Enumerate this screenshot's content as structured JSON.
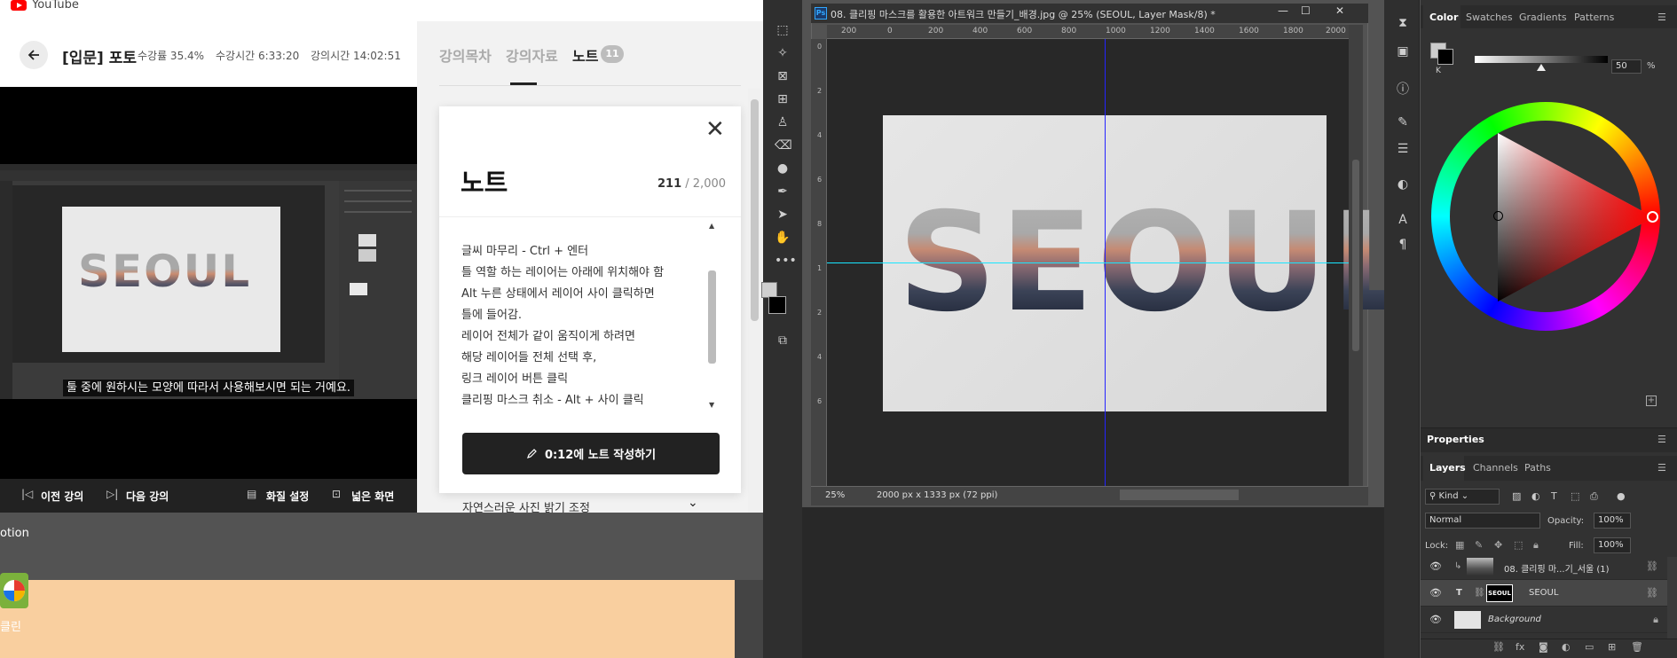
{
  "desktop": {
    "icon_label_1": "otion",
    "icon_label_2": "클린"
  },
  "lecture": {
    "site_name": "YouTube",
    "back_icon": "arrow-left-icon",
    "title": "[입문] 포토",
    "stats": {
      "progress": "수강률 35.4%",
      "watch_time": "수강시간 6:33:20",
      "length": "강의시간 14:02:51"
    },
    "video": {
      "subtitle": "툴 중에 원하시는 모양에 따라서 사용해보시면 되는 거예요.",
      "embedded_text": "SEOUL"
    },
    "controls": {
      "prev": "이전 강의",
      "next": "다음 강의",
      "quality": "화질 설정",
      "wide": "넓은 화면"
    },
    "tabs": {
      "curriculum": "강의목차",
      "materials": "강의자료",
      "notes": "노트",
      "notes_count": "11"
    },
    "note": {
      "heading": "노트",
      "char_count": "211",
      "char_limit": " / 2,000",
      "lines": [
        "글씨 마무리 - Ctrl + 엔터",
        "틀 역할 하는 레이어는 아래에 위치해야 함",
        "Alt 누른 상태에서 레이어 사이 클릭하면",
        "틀에 들어감.",
        "레이어 전체가 같이 움직이게 하려면",
        "해당 레이어들 전체 선택 후,",
        "링크 레이어 버튼 클릭",
        "클리핑 마스크 취소 - Alt  + 사이 클릭"
      ],
      "write_button": "0:12에 노트 작성하기"
    },
    "next_section": "자연스러운 사진 밝기 조정"
  },
  "photoshop": {
    "document": {
      "app_badge": "Ps",
      "title": "08. 클리핑 마스크를 활용한 아트워크 만들기_배경.jpg @ 25% (SEOUL, Layer Mask/8) *",
      "canvas_text": "SEOUL",
      "ruler_top": [
        "200",
        "0",
        "200",
        "400",
        "600",
        "800",
        "1000",
        "1200",
        "1400",
        "1600",
        "1800",
        "2000"
      ],
      "ruler_left": [
        "0",
        "2",
        "4",
        "6",
        "8",
        "1",
        "2",
        "4",
        "6"
      ],
      "zoom": "25%",
      "doc_info": "2000 px x 1333 px (72 ppi)",
      "guide_v_color": "#2424ff",
      "guide_h_color": "#18e6ff"
    },
    "color_panel": {
      "tabs": [
        "Color",
        "Swatches",
        "Gradients",
        "Patterns"
      ],
      "channel_label": "K",
      "k_value": "50",
      "percent": "%",
      "k_level_percent": 50,
      "fg_color": "#cccccc",
      "bg_color": "#000000"
    },
    "properties_tab": "Properties",
    "layers_panel": {
      "tabs": [
        "Layers",
        "Channels",
        "Paths"
      ],
      "kind": "Kind",
      "blend_mode": "Normal",
      "opacity_label": "Opacity:",
      "opacity": "100%",
      "lock_label": "Lock:",
      "fill_label": "Fill:",
      "fill": "100%",
      "layers": [
        {
          "name": "08. 클리핑 마...기_서울 (1)",
          "type": "photo-clipped"
        },
        {
          "name": "SEOUL",
          "type": "text-with-mask",
          "thumb_text": "SEOUL"
        },
        {
          "name": "Background",
          "type": "background"
        }
      ]
    }
  }
}
